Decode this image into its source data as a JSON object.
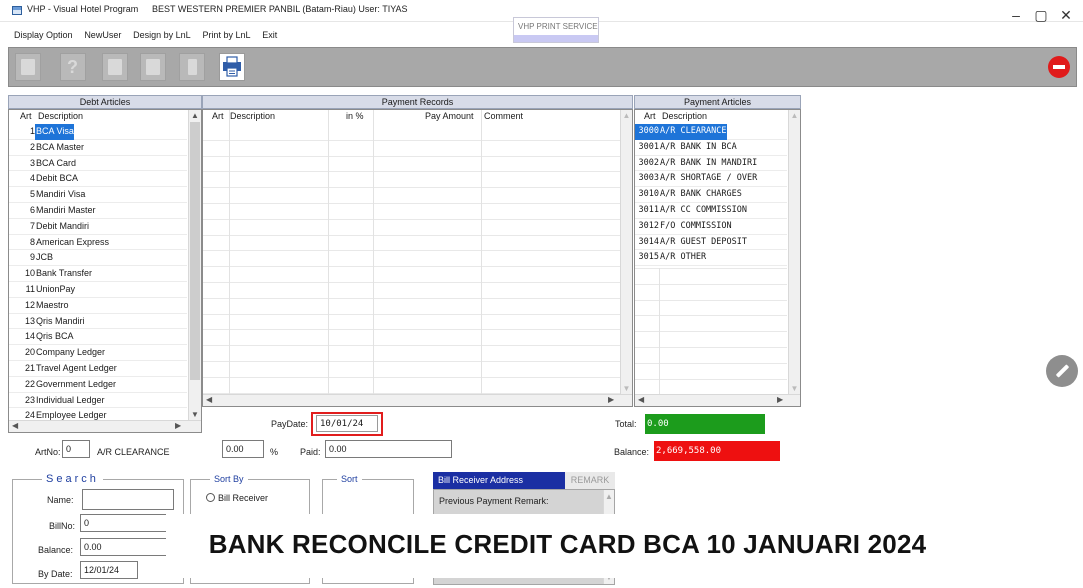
{
  "window": {
    "title": "VHP - Visual Hotel Program",
    "hotel_user": "BEST WESTERN PREMIER PANBIL (Batam-Riau) User: TIYAS",
    "print_service": "VHP PRINT SERVICE",
    "controls": {
      "minimize": "–",
      "restore": "▢",
      "close": "✕"
    }
  },
  "menu": [
    "Display Option",
    "NewUser",
    "Design by LnL",
    "Print by LnL",
    "Exit"
  ],
  "toolbar": {
    "buttons": [
      "new-icon",
      "help-icon",
      "save-icon",
      "edit-icon",
      "delete-icon",
      "print-icon"
    ],
    "help_glyph": "?",
    "stop": "stop-icon"
  },
  "debt_articles": {
    "header": "Debt Articles",
    "col_art": "Art",
    "col_desc": "Description",
    "items": [
      {
        "art": "1",
        "desc": "BCA Visa",
        "selected": true
      },
      {
        "art": "2",
        "desc": "BCA Master"
      },
      {
        "art": "3",
        "desc": "BCA Card"
      },
      {
        "art": "4",
        "desc": "Debit BCA"
      },
      {
        "art": "5",
        "desc": "Mandiri Visa"
      },
      {
        "art": "6",
        "desc": "Mandiri Master"
      },
      {
        "art": "7",
        "desc": "Debit Mandiri"
      },
      {
        "art": "8",
        "desc": "American Express"
      },
      {
        "art": "9",
        "desc": "JCB"
      },
      {
        "art": "10",
        "desc": "Bank Transfer"
      },
      {
        "art": "11",
        "desc": "UnionPay"
      },
      {
        "art": "12",
        "desc": "Maestro"
      },
      {
        "art": "13",
        "desc": "Qris Mandiri"
      },
      {
        "art": "14",
        "desc": "Qris BCA"
      },
      {
        "art": "20",
        "desc": "Company Ledger"
      },
      {
        "art": "21",
        "desc": "Travel Agent Ledger"
      },
      {
        "art": "22",
        "desc": "Government Ledger"
      },
      {
        "art": "23",
        "desc": "Individual Ledger"
      },
      {
        "art": "24",
        "desc": "Employee Ledger"
      }
    ]
  },
  "payment_records": {
    "header": "Payment Records",
    "columns": [
      "Art",
      "Description",
      "in %",
      "Pay Amount",
      "Comment"
    ]
  },
  "payment_articles": {
    "header": "Payment Articles",
    "col_art": "Art",
    "col_desc": "Description",
    "items": [
      {
        "art": "3000",
        "desc": "A/R CLEARANCE",
        "selected": true
      },
      {
        "art": "3001",
        "desc": "A/R BANK IN BCA"
      },
      {
        "art": "3002",
        "desc": "A/R BANK IN MANDIRI"
      },
      {
        "art": "3003",
        "desc": "A/R SHORTAGE / OVER"
      },
      {
        "art": "3010",
        "desc": "A/R BANK CHARGES"
      },
      {
        "art": "3011",
        "desc": "A/R CC COMMISSION"
      },
      {
        "art": "3012",
        "desc": "F/O COMMISSION"
      },
      {
        "art": "3014",
        "desc": "A/R GUEST DEPOSIT"
      },
      {
        "art": "3015",
        "desc": "A/R OTHER"
      }
    ]
  },
  "form": {
    "paydate_label": "PayDate:",
    "paydate_value": "10/01/24",
    "artno_label": "ArtNo:",
    "artno_value": "0",
    "artno_desc": "A/R CLEARANCE",
    "percent_value": "0.00",
    "percent_sign": "%",
    "paid_label": "Paid:",
    "paid_value": "0.00",
    "total_label": "Total:",
    "total_value": "0.00",
    "balance_label": "Balance:",
    "balance_value": "2,669,558.00"
  },
  "search": {
    "title": "Search",
    "name_label": "Name:",
    "name_value": "",
    "billno_label": "BillNo:",
    "billno_value": "0",
    "balance_label": "Balance:",
    "balance_value": "0.00",
    "bydate_label": "By Date:",
    "bydate_value": "12/01/24"
  },
  "sort_by": {
    "title": "Sort By",
    "option1": "Bill Receiver"
  },
  "sort": {
    "title": "Sort"
  },
  "bill_receiver": {
    "tab": "Bill Receiver Address",
    "remark_tab": "REMARK",
    "prev_remark": "Previous Payment Remark:"
  },
  "banner": {
    "text": "BANK RECONCILE CREDIT CARD BCA 10 JANUARI 2024"
  },
  "colors": {
    "selection": "#1e74d8",
    "total_bg": "#1c9c1c",
    "balance_bg": "#ee1010",
    "bill_tab": "#1b2fa3",
    "highlight": "#e11d1d"
  }
}
